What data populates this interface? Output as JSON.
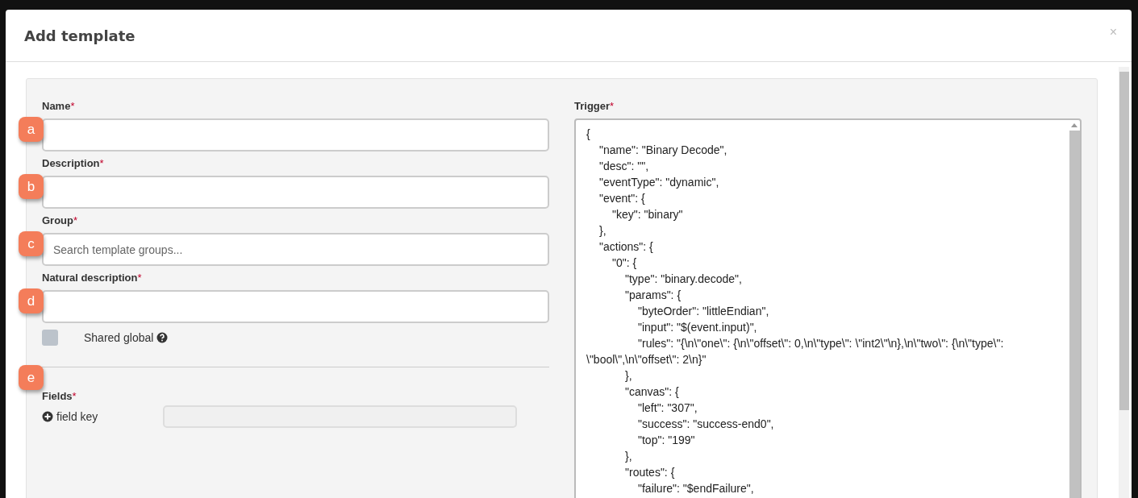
{
  "dialog": {
    "title": "Add template",
    "close": "×"
  },
  "form": {
    "fields": [
      {
        "label": "Name",
        "required_mark": "*",
        "marker": "a"
      },
      {
        "label": "Description",
        "required_mark": "*",
        "marker": "b"
      },
      {
        "label": "Group",
        "required_mark": "*",
        "marker": "c",
        "placeholder": "Search template groups..."
      },
      {
        "label": "Natural description",
        "required_mark": "*",
        "marker": "d"
      }
    ],
    "shared_global": {
      "label": "Shared global",
      "checked": false
    },
    "fields_section": {
      "label": "Fields",
      "required_mark": "*",
      "add_label": "field key",
      "marker": "e"
    },
    "trigger": {
      "label": "Trigger",
      "required_mark": "*",
      "value": "{\n\t\"name\": \"Binary Decode\",\n\t\"desc\": \"\",\n\t\"eventType\": \"dynamic\",\n\t\"event\": {\n\t\t\"key\": \"binary\"\n\t},\n\t\"actions\": {\n\t\t\"0\": {\n\t\t\t\"type\": \"binary.decode\",\n\t\t\t\"params\": {\n\t\t\t\t\"byteOrder\": \"littleEndian\",\n\t\t\t\t\"input\": \"$(event.input)\",\n\t\t\t\t\"rules\": \"{\\n\\\"one\\\": {\\n\\\"offset\\\": 0,\\n\\\"type\\\": \\\"int2\\\"\\n},\\n\\\"two\\\": {\\n\\\"type\\\": \\\"bool\\\",\\n\\\"offset\\\": 2\\n}\"\n\t\t\t},\n\t\t\t\"canvas\": {\n\t\t\t\t\"left\": \"307\",\n\t\t\t\t\"success\": \"success-end0\",\n\t\t\t\t\"top\": \"199\"\n\t\t\t},\n\t\t\t\"routes\": {\n\t\t\t\t\"failure\": \"$endFailure\","
    }
  }
}
